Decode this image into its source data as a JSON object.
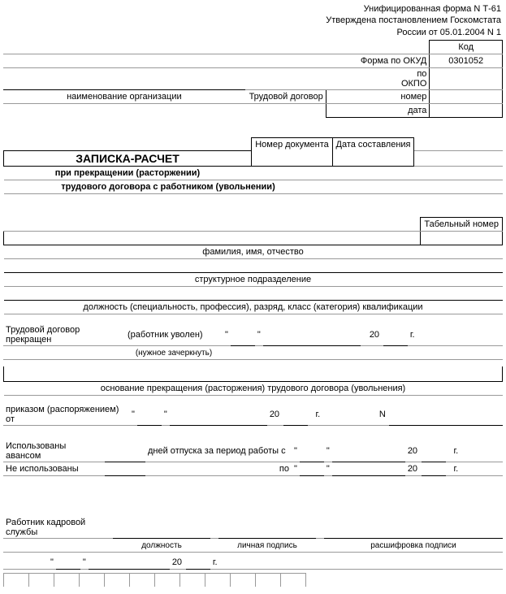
{
  "header": {
    "line1": "Унифицированная форма N Т-61",
    "line2": "Утверждена постановлением Госкомстата",
    "line3": "России от 05.01.2004 N 1"
  },
  "codes": {
    "kod_label": "Код",
    "okud_label": "Форма по ОКУД",
    "okud_value": "0301052",
    "okpo_label": "по ОКПО",
    "org_label": "наименование организации",
    "td_label": "Трудовой договор",
    "nomer_label": "номер",
    "data_label": "дата"
  },
  "titleblock": {
    "num_doc": "Номер документа",
    "date_doc": "Дата составления",
    "title": "ЗАПИСКА-РАСЧЕТ",
    "sub1": "при прекращении (расторжении)",
    "sub2": "трудового договора с работником (увольнении)"
  },
  "rows": {
    "tabnum": "Табельный номер",
    "fio": "фамилия, имя, отчество",
    "struct": "структурное подразделение",
    "position": "должность (специальность, профессия), разряд, класс (категория) квалификации"
  },
  "termination": {
    "prefix": "Трудовой договор прекращен",
    "uvolen": "(работник уволен)",
    "nuzh": "(нужное зачеркнуть)",
    "year20": "20",
    "g": "г.",
    "osnov": "основание прекращения (расторжения) трудового договора (увольнения)",
    "prikaz": "приказом (распоряжением) от",
    "N": "N"
  },
  "vacation": {
    "avans": "Использованы авансом",
    "neisp": "Не использованы",
    "dnei": "дней отпуска за период работы с",
    "po": "по",
    "year20": "20",
    "g": "г."
  },
  "signer": {
    "label": "Работник кадровой службы",
    "pos": "должность",
    "sig": "личная подпись",
    "dec": "расшифровка подписи",
    "year20": "20",
    "g": "г."
  },
  "q": "\""
}
